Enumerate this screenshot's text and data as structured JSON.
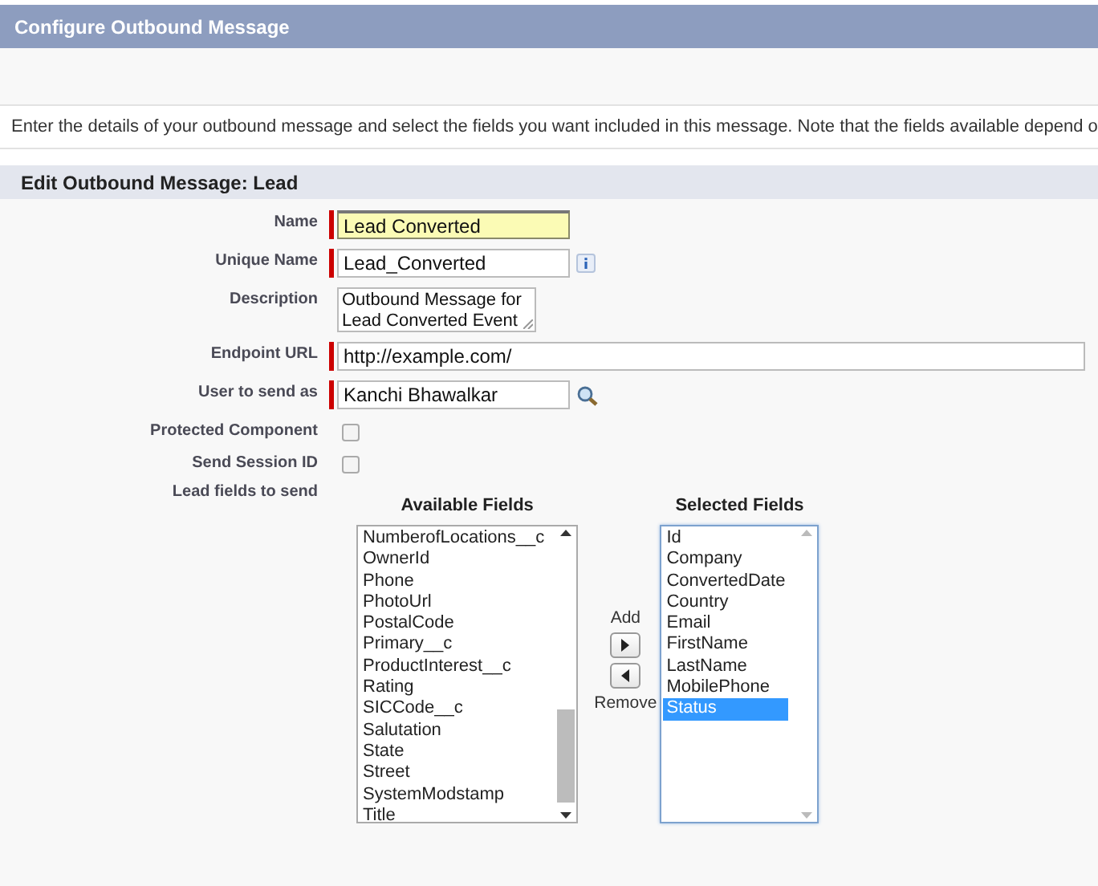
{
  "header": {
    "title": "Configure Outbound Message"
  },
  "intro": "Enter the details of your outbound message and select the fields you want included in this message. Note that the fields available depend o",
  "section": {
    "title": "Edit Outbound Message: Lead"
  },
  "fields": [
    {
      "kind": "text",
      "label": "Name",
      "value": "Lead Converted",
      "required": true,
      "focused": true
    },
    {
      "kind": "info",
      "label": "Unique Name",
      "value": "Lead_Converted",
      "required": true,
      "focused": false
    },
    {
      "kind": "textarea",
      "label": "Description",
      "value": "Outbound Message for Lead Converted Event"
    },
    {
      "kind": "wide",
      "label": "Endpoint URL",
      "value": "http://example.com/",
      "required": true,
      "focused": false
    },
    {
      "kind": "lookup",
      "label": "User to send as",
      "value": "Kanchi Bhawalkar",
      "required": true,
      "focused": false
    },
    {
      "kind": "checkbox",
      "label": "Protected Component",
      "checked": false
    },
    {
      "kind": "checkbox",
      "label": "Send Session ID",
      "checked": false
    }
  ],
  "lead_fields": {
    "label": "Lead fields to send",
    "available": {
      "title": "Available Fields",
      "items": [
        {
          "label": "NumberofLocations__c",
          "selected": false
        },
        {
          "label": "OwnerId",
          "selected": false
        },
        {
          "label": "Phone",
          "selected": false
        },
        {
          "label": "PhotoUrl",
          "selected": false
        },
        {
          "label": "PostalCode",
          "selected": false
        },
        {
          "label": "Primary__c",
          "selected": false
        },
        {
          "label": "ProductInterest__c",
          "selected": false
        },
        {
          "label": "Rating",
          "selected": false
        },
        {
          "label": "SICCode__c",
          "selected": false
        },
        {
          "label": "Salutation",
          "selected": false
        },
        {
          "label": "State",
          "selected": false
        },
        {
          "label": "Street",
          "selected": false
        },
        {
          "label": "SystemModstamp",
          "selected": false
        },
        {
          "label": "Title",
          "selected": false
        }
      ]
    },
    "add_label": "Add",
    "remove_label": "Remove",
    "selected": {
      "title": "Selected Fields",
      "items": [
        {
          "label": "Id",
          "selected": false
        },
        {
          "label": "Company",
          "selected": false
        },
        {
          "label": "ConvertedDate",
          "selected": false
        },
        {
          "label": "Country",
          "selected": false
        },
        {
          "label": "Email",
          "selected": false
        },
        {
          "label": "FirstName",
          "selected": false
        },
        {
          "label": "LastName",
          "selected": false
        },
        {
          "label": "MobilePhone",
          "selected": false
        },
        {
          "label": "Status",
          "selected": true
        }
      ]
    }
  }
}
